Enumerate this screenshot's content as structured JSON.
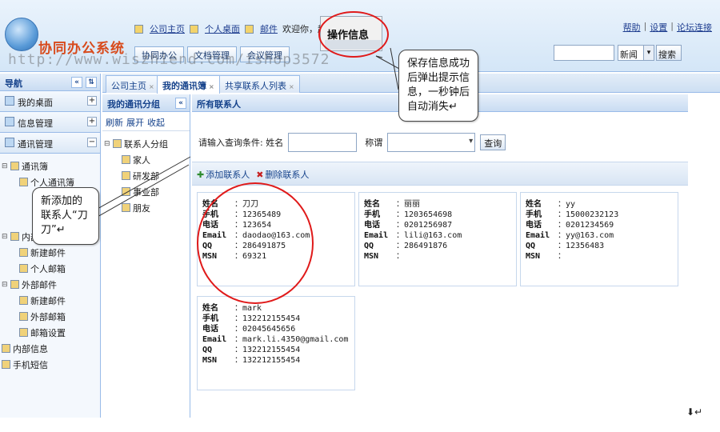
{
  "app": {
    "title": "协同办公系统",
    "watermark": "http://www.wiszhiend.com/ishop3572",
    "top_links": [
      "公司主页",
      "个人桌面",
      "邮件"
    ],
    "welcome": "欢迎你，超级管理员",
    "op_popup": "操作信息",
    "modules": [
      "协同办公",
      "文档管理",
      "会议管理"
    ],
    "right_links": [
      "帮助",
      "设置",
      "论坛连接"
    ],
    "right_sep": "|",
    "search_type": "新闻",
    "search_drop": "▾",
    "search_button": "搜索"
  },
  "nav": {
    "title": "导航",
    "tools": [
      "«",
      "⇅"
    ],
    "sections": [
      {
        "label": "我的桌面",
        "pm": "+"
      },
      {
        "label": "信息管理",
        "pm": "+"
      },
      {
        "label": "通讯管理",
        "pm": "−"
      }
    ],
    "tree": [
      {
        "label": "通讯簿",
        "level": 1,
        "exp": "⊟"
      },
      {
        "label": "个人通讯簿",
        "level": 2
      },
      {
        "label": "内部邮件",
        "level": 1,
        "exp": "⊟"
      },
      {
        "label": "新建邮件",
        "level": 2
      },
      {
        "label": "个人邮箱",
        "level": 2
      },
      {
        "label": "外部邮件",
        "level": 1,
        "exp": "⊟"
      },
      {
        "label": "新建邮件",
        "level": 2
      },
      {
        "label": "外部邮箱",
        "level": 2
      },
      {
        "label": "邮箱设置",
        "level": 2
      },
      {
        "label": "内部信息",
        "level": 1
      },
      {
        "label": "手机短信",
        "level": 1
      }
    ]
  },
  "tabs": [
    {
      "label": "公司主页",
      "x": "×"
    },
    {
      "label": "我的通讯簿",
      "x": "×"
    },
    {
      "label": "共享联系人列表",
      "x": "×"
    }
  ],
  "group": {
    "title": "我的通讯分组",
    "collapse": "«",
    "tools": [
      "刷新",
      "展开",
      "收起"
    ],
    "tree": [
      {
        "label": "联系人分组",
        "exp": "⊟"
      },
      {
        "label": "家人"
      },
      {
        "label": "研发部"
      },
      {
        "label": "事业部"
      },
      {
        "label": "朋友"
      }
    ]
  },
  "main": {
    "title": "所有联系人",
    "query_label": "请输入查询条件: 姓名",
    "query_label2": "称谓",
    "query_button": "查询",
    "add_button": "添加联系人",
    "delete_button": "删除联系人",
    "field_labels": [
      "姓名",
      "手机",
      "电话",
      "Email",
      "QQ",
      "MSN"
    ],
    "contacts": [
      {
        "name": "刀刀",
        "mobile": "12365489",
        "phone": "123654",
        "email": "daodao@163.com",
        "qq": "286491875",
        "msn": "69321"
      },
      {
        "name": "丽丽",
        "mobile": "1203654698",
        "phone": "0201256987",
        "email": "lili@163.com",
        "qq": "286491876",
        "msn": ""
      },
      {
        "name": "yy",
        "mobile": "15000232123",
        "phone": "0201234569",
        "email": "yy@163.com",
        "qq": "12356483",
        "msn": ""
      },
      {
        "name": "mark",
        "mobile": "132212155454",
        "phone": "02045645656",
        "email": "mark.li.4350@gmail.com",
        "qq": "132212155454",
        "msn": "132212155454"
      }
    ]
  },
  "annotations": {
    "save_info": "保存信息成功后弹出提示信息，一秒钟后自动消失↵",
    "new_contact": "新添加的联系人“刀刀”↵",
    "corner": "⬇↵",
    "highlight_color": "#e01a1a"
  }
}
